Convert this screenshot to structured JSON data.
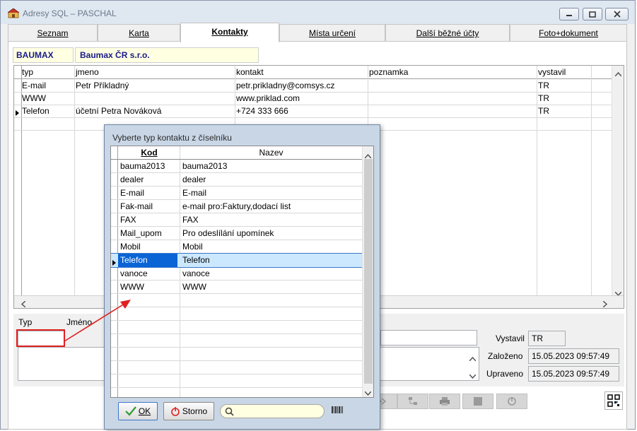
{
  "window": {
    "title": "Adresy SQL – PASCHAL"
  },
  "tabs": [
    {
      "label": "Seznam"
    },
    {
      "label": "Karta"
    },
    {
      "label": "Kontakty"
    },
    {
      "label": "Místa určení"
    },
    {
      "label": "Další běžné účty"
    },
    {
      "label": "Foto+dokument"
    }
  ],
  "company": {
    "code": "BAUMAX",
    "name": "Baumax ČR s.r.o."
  },
  "contacts_grid": {
    "columns": [
      "typ",
      "jmeno",
      "kontakt",
      "poznamka",
      "vystavil"
    ],
    "rows": [
      {
        "typ": "E-mail",
        "jmeno": "Petr Příkladný",
        "kontakt": "petr.prikladny@comsys.cz",
        "poznamka": "",
        "vystavil": "TR"
      },
      {
        "typ": "WWW",
        "jmeno": "",
        "kontakt": "www.priklad.com",
        "poznamka": "",
        "vystavil": "TR"
      },
      {
        "typ": "Telefon",
        "jmeno": "účetní Petra Nováková",
        "kontakt": "+724 333 666",
        "poznamka": "",
        "vystavil": "TR"
      }
    ]
  },
  "detail": {
    "typ_label": "Typ",
    "jmeno_label": "Jméno",
    "vystavil_label": "Vystavil",
    "vystavil_value": "TR",
    "zalozeno_label": "Založeno",
    "zalozeno_value": "15.05.2023 09:57:49",
    "upraveno_label": "Upraveno",
    "upraveno_value": "15.05.2023 09:57:49"
  },
  "dialog": {
    "title": "Vyberte typ kontaktu z číselníku",
    "columns": [
      "Kod",
      "Nazev"
    ],
    "rows": [
      {
        "kod": "bauma2013",
        "nazev": "bauma2013"
      },
      {
        "kod": "dealer",
        "nazev": "dealer"
      },
      {
        "kod": "E-mail",
        "nazev": "E-mail"
      },
      {
        "kod": "Fak-mail",
        "nazev": "e-mail pro:Faktury,dodací list"
      },
      {
        "kod": "FAX",
        "nazev": "FAX"
      },
      {
        "kod": "Mail_upom",
        "nazev": "Pro odeslílání upomínek"
      },
      {
        "kod": "Mobil",
        "nazev": "Mobil"
      },
      {
        "kod": "Telefon",
        "nazev": "Telefon"
      },
      {
        "kod": "vanoce",
        "nazev": "vanoce"
      },
      {
        "kod": "WWW",
        "nazev": "WWW"
      }
    ],
    "selected_index": 7,
    "ok_label": "OK",
    "storno_label": "Storno",
    "search_value": ""
  },
  "colors": {
    "selection": "#cce8ff",
    "annotation": "#e02020",
    "company_text": "#1a1a8c"
  }
}
